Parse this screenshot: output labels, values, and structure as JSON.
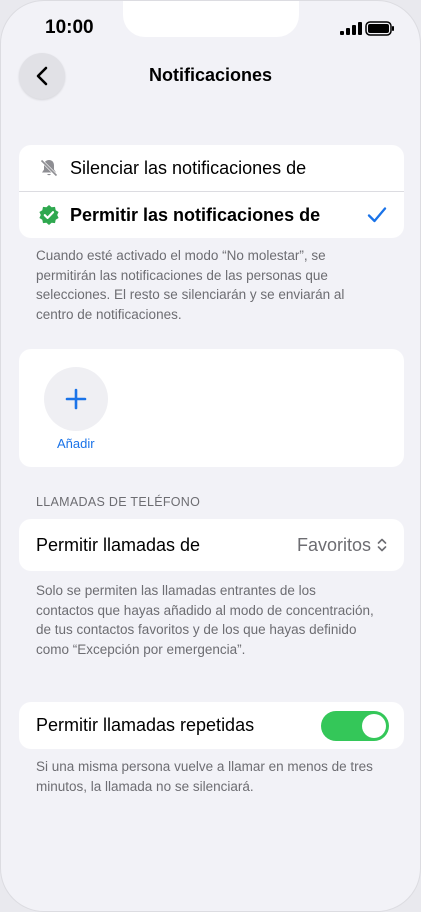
{
  "status_bar": {
    "time": "10:00"
  },
  "header": {
    "title": "Notificaciones"
  },
  "options": [
    {
      "label": "Silenciar las notificaciones de",
      "selected": false
    },
    {
      "label": "Permitir las notificaciones de",
      "selected": true
    }
  ],
  "options_note": "Cuando esté activado el modo “No molestar”, se permitirán las notificaciones de las personas que selecciones. El resto se silenciarán y se enviarán al centro de notificaciones.",
  "people": {
    "add_label": "Añadir"
  },
  "calls": {
    "header": "LLAMADAS DE TELÉFONO",
    "allow_label": "Permitir llamadas de",
    "allow_value": "Favoritos",
    "note": "Solo se permiten las llamadas entrantes de los contactos que hayas añadido al modo de concentración, de tus contactos favoritos y de los que hayas definido como “Excepción por emergencia”."
  },
  "repeated": {
    "label": "Permitir llamadas repetidas",
    "enabled": true,
    "note": "Si una misma persona vuelve a llamar en menos de tres minutos, la llamada no se silenciará."
  },
  "colors": {
    "accent": "#1a73e8",
    "toggle_on": "#34c759",
    "allow_icon": "#2fa84f"
  }
}
